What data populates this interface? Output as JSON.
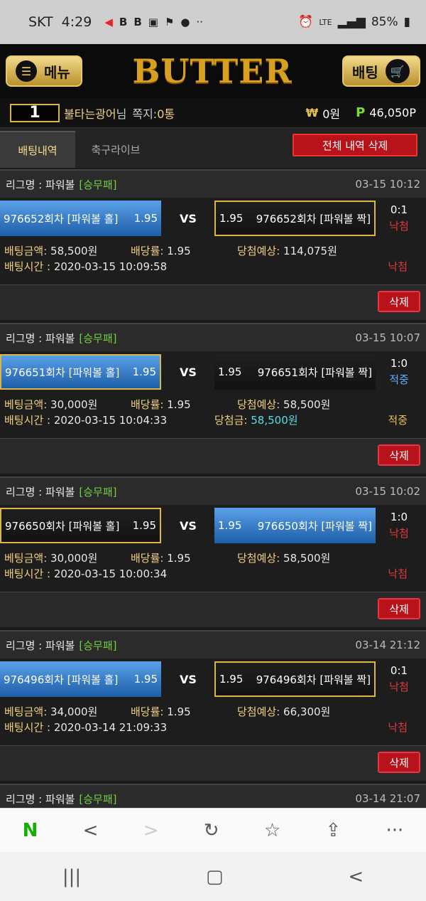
{
  "status_bar": {
    "carrier": "SKT",
    "time": "4:29",
    "battery": "85%",
    "network": "LTE"
  },
  "header": {
    "menu_label": "메뉴",
    "logo": "BUTTER",
    "bet_label": "배팅"
  },
  "user": {
    "level": "1",
    "name": "불타는광어",
    "suffix": "님",
    "messages_label": "쪽지:",
    "messages_count": "0통",
    "won_symbol": "₩",
    "cash": "0원",
    "points_symbol": "P",
    "points": "46,050P"
  },
  "tabs": {
    "active": "배팅내역",
    "inactive": "축구라이브",
    "delete_all": "전체 내역 삭제"
  },
  "bets": [
    {
      "league": "리그명 : 파워볼",
      "type": "[승무패]",
      "time": "03-15 10:12",
      "home": "976652회차 [파워볼 홀]",
      "home_odds": "1.95",
      "away": "976652회차 [파워볼 짝]",
      "away_odds": "1.95",
      "score": "0:1",
      "status_top": "낙첨",
      "amount_label": "배팅금액:",
      "amount": "58,500원",
      "rate_label": "배당률:",
      "rate": "1.95",
      "expected_label": "당첨예상:",
      "expected": "114,075원",
      "time_label": "배팅시간 :",
      "bet_time": "2020-03-15 10:09:58",
      "win_label": "",
      "win": "",
      "status_bottom": "낙첨",
      "delete": "삭제"
    },
    {
      "league": "리그명 : 파워볼",
      "type": "[승무패]",
      "time": "03-15 10:07",
      "home": "976651회차 [파워볼 홀]",
      "home_odds": "1.95",
      "away": "976651회차 [파워볼 짝]",
      "away_odds": "1.95",
      "score": "1:0",
      "status_top": "적중",
      "amount_label": "베팅금액:",
      "amount": "30,000원",
      "rate_label": "배당률:",
      "rate": "1.95",
      "expected_label": "당첨예상:",
      "expected": "58,500원",
      "time_label": "배팅시간 :",
      "bet_time": "2020-03-15 10:04:33",
      "win_label": "당첨금:",
      "win": "58,500원",
      "status_bottom": "적중",
      "delete": "삭제"
    },
    {
      "league": "리그명 : 파워볼",
      "type": "[승무패]",
      "time": "03-15 10:02",
      "home": "976650회차 [파워볼 홀]",
      "home_odds": "1.95",
      "away": "976650회차 [파워볼 짝]",
      "away_odds": "1.95",
      "score": "1:0",
      "status_top": "낙첨",
      "amount_label": "베팅금액:",
      "amount": "30,000원",
      "rate_label": "배당률:",
      "rate": "1.95",
      "expected_label": "당첨예상:",
      "expected": "58,500원",
      "time_label": "배팅시간 :",
      "bet_time": "2020-03-15 10:00:34",
      "win_label": "",
      "win": "",
      "status_bottom": "낙첨",
      "delete": "삭제"
    },
    {
      "league": "리그명 : 파워볼",
      "type": "[승무패]",
      "time": "03-14 21:12",
      "home": "976496회차 [파워볼 홀]",
      "home_odds": "1.95",
      "away": "976496회차 [파워볼 짝]",
      "away_odds": "1.95",
      "score": "0:1",
      "status_top": "낙첨",
      "amount_label": "베팅금액:",
      "amount": "34,000원",
      "rate_label": "배당률:",
      "rate": "1.95",
      "expected_label": "당첨예상:",
      "expected": "66,300원",
      "time_label": "배팅시간 :",
      "bet_time": "2020-03-14 21:09:33",
      "win_label": "",
      "win": "",
      "status_bottom": "낙첨",
      "delete": "삭제"
    },
    {
      "league": "리그명 : 파워볼",
      "type": "[승무패]",
      "time": "03-14 21:07"
    }
  ],
  "colors": {
    "accent_gold": "#d8b64a",
    "delete_red": "#b8121b",
    "win_blue": "#5ab0ff",
    "lose_red": "#e03a3a",
    "league_green": "#6fcf3c"
  }
}
